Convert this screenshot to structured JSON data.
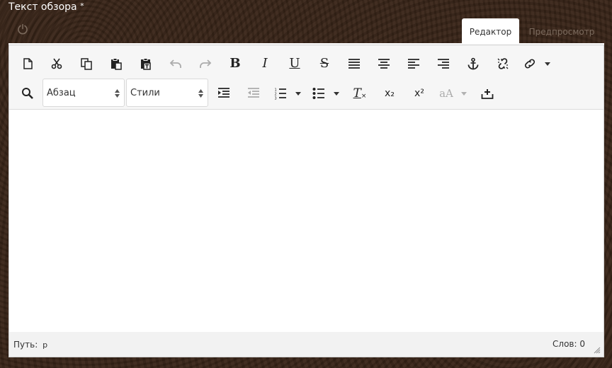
{
  "field": {
    "label": "Текст обзора",
    "required_mark": "*"
  },
  "tabs": [
    {
      "label": "Редактор",
      "active": true
    },
    {
      "label": "Предпросмотр",
      "active": false
    }
  ],
  "toolbar": {
    "row1": [
      {
        "name": "new-document-icon"
      },
      {
        "name": "cut-icon"
      },
      {
        "name": "copy-icon"
      },
      {
        "name": "paste-icon"
      },
      {
        "name": "paste-text-icon"
      },
      {
        "name": "undo-icon",
        "disabled": true
      },
      {
        "name": "redo-icon",
        "disabled": true
      },
      {
        "name": "bold-icon",
        "glyph": "B"
      },
      {
        "name": "italic-icon",
        "glyph": "I"
      },
      {
        "name": "underline-icon",
        "glyph": "U"
      },
      {
        "name": "strikethrough-icon",
        "glyph": "S"
      },
      {
        "name": "align-justify-icon"
      },
      {
        "name": "align-center-icon"
      },
      {
        "name": "align-left-icon"
      },
      {
        "name": "align-right-icon"
      },
      {
        "name": "anchor-icon"
      },
      {
        "name": "unlink-icon"
      },
      {
        "name": "link-icon"
      }
    ],
    "format_select": {
      "value": "Абзац"
    },
    "styles_select": {
      "value": "Стили"
    },
    "superscript_glyph": "x²",
    "subscript_glyph": "x₂",
    "clear_format_glyph": "T",
    "font_size_glyph": "aA"
  },
  "status": {
    "path_label": "Путь:",
    "path_tag": "p",
    "words_label": "Слов:",
    "words_count": "0"
  },
  "colors": {
    "background": "#3a2619",
    "toolbar": "#f6f6f6",
    "icon": "#222222"
  }
}
